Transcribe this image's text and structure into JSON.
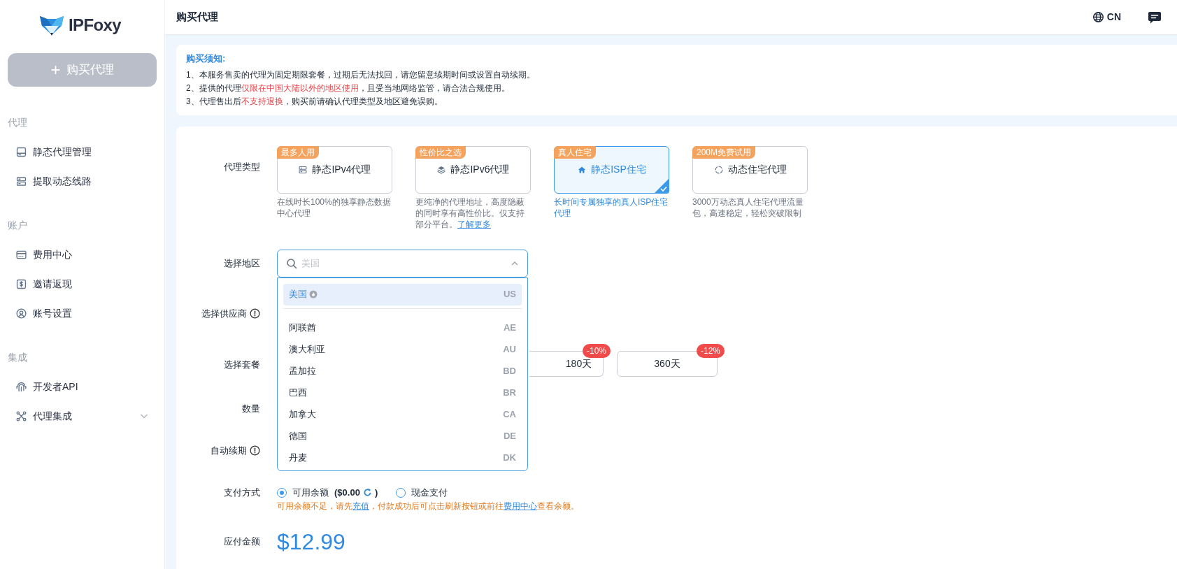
{
  "sidebar": {
    "logo": "IPFoxy",
    "buy_button": {
      "icon": "+",
      "label": "购买代理"
    },
    "sections": [
      {
        "title": "代理",
        "items": [
          {
            "label": "静态代理管理",
            "selected": false
          },
          {
            "label": "提取动态线路",
            "selected": false
          }
        ]
      },
      {
        "title": "账户",
        "items": [
          {
            "label": "费用中心",
            "selected": false
          },
          {
            "label": "邀请返现",
            "selected": false
          },
          {
            "label": "账号设置",
            "selected": false
          }
        ]
      },
      {
        "title": "集成",
        "items": [
          {
            "label": "开发者API",
            "selected": false
          },
          {
            "label": "代理集成",
            "selected": false,
            "expanded": false
          }
        ]
      }
    ]
  },
  "header": {
    "title": "购买代理",
    "language": "CN"
  },
  "notice": {
    "title": "购买须知:",
    "lines": [
      [
        {
          "text": "1、本服务售卖的代理为固定期限套餐，过期后无法找回，请您留意续期时间或设置自动续期。",
          "highlight": false
        }
      ],
      [
        {
          "text": "2、提供的代理",
          "highlight": false
        },
        {
          "text": "仅限在中国大陆以外的地区使用",
          "highlight": true
        },
        {
          "text": "，且受当地网络监管，请合法合规使用。",
          "highlight": false
        }
      ],
      [
        {
          "text": "3、代理售出后",
          "highlight": false
        },
        {
          "text": "不支持退换",
          "highlight": true
        },
        {
          "text": "，购买前请确认代理类型及地区避免误购。",
          "highlight": false
        }
      ]
    ]
  },
  "form": {
    "proxy_type": {
      "label": "代理类型",
      "options": [
        {
          "badge": "最多人用",
          "name": "静态IPv4代理",
          "description": "在线时长100%的独享静态数据中心代理",
          "selected": false
        },
        {
          "badge": "性价比之选",
          "name": "静态IPv6代理",
          "description": "更纯净的代理地址，高度隐蔽的同时享有高性价比。仅支持部分平台。",
          "link": "了解更多",
          "selected": false
        },
        {
          "badge": "真人住宅",
          "name": "静态ISP住宅",
          "description": "长时间专属独享的真人ISP住宅代理",
          "selected": true
        },
        {
          "badge": "200M免费试用",
          "name": "动态住宅代理",
          "description": "3000万动态真人住宅代理流量包，高速稳定，轻松突破限制",
          "selected": false
        }
      ]
    },
    "region": {
      "label": "选择地区",
      "placeholder": "美国",
      "expanded": true,
      "options": [
        {
          "name": "美国",
          "code": "US",
          "hot": true,
          "selected": true
        },
        {
          "name": "阿联酋",
          "code": "AE",
          "hot": false,
          "selected": false
        },
        {
          "name": "澳大利亚",
          "code": "AU",
          "hot": false,
          "selected": false
        },
        {
          "name": "孟加拉",
          "code": "BD",
          "hot": false,
          "selected": false
        },
        {
          "name": "巴西",
          "code": "BR",
          "hot": false,
          "selected": false
        },
        {
          "name": "加拿大",
          "code": "CA",
          "hot": false,
          "selected": false
        },
        {
          "name": "德国",
          "code": "DE",
          "hot": false,
          "selected": false
        },
        {
          "name": "丹麦",
          "code": "DK",
          "hot": false,
          "selected": false
        }
      ]
    },
    "supplier": {
      "label": "选择供应商",
      "info": true
    },
    "package": {
      "label": "选择套餐",
      "plans": [
        {
          "label": "180天",
          "discount": "-10%"
        },
        {
          "label": "360天",
          "discount": "-12%"
        }
      ]
    },
    "quantity": {
      "label": "数量"
    },
    "auto_renew": {
      "label": "自动续期",
      "info": true
    },
    "payment": {
      "label": "支付方式",
      "methods": [
        {
          "label": "可用余额",
          "balance": "($0.00",
          "balance_end": ")",
          "refresh": true,
          "selected": true
        },
        {
          "label": "现金支付",
          "selected": false
        }
      ],
      "warning": [
        {
          "text": "可用余额不足，请先",
          "kind": "text"
        },
        {
          "text": "充值",
          "kind": "link"
        },
        {
          "text": "，付款成功后可点击刷新按钮或前往",
          "kind": "text"
        },
        {
          "text": "费用中心",
          "kind": "link"
        },
        {
          "text": "查看余额。",
          "kind": "text"
        }
      ]
    },
    "amount": {
      "label": "应付金额",
      "value": "$12.99"
    }
  }
}
